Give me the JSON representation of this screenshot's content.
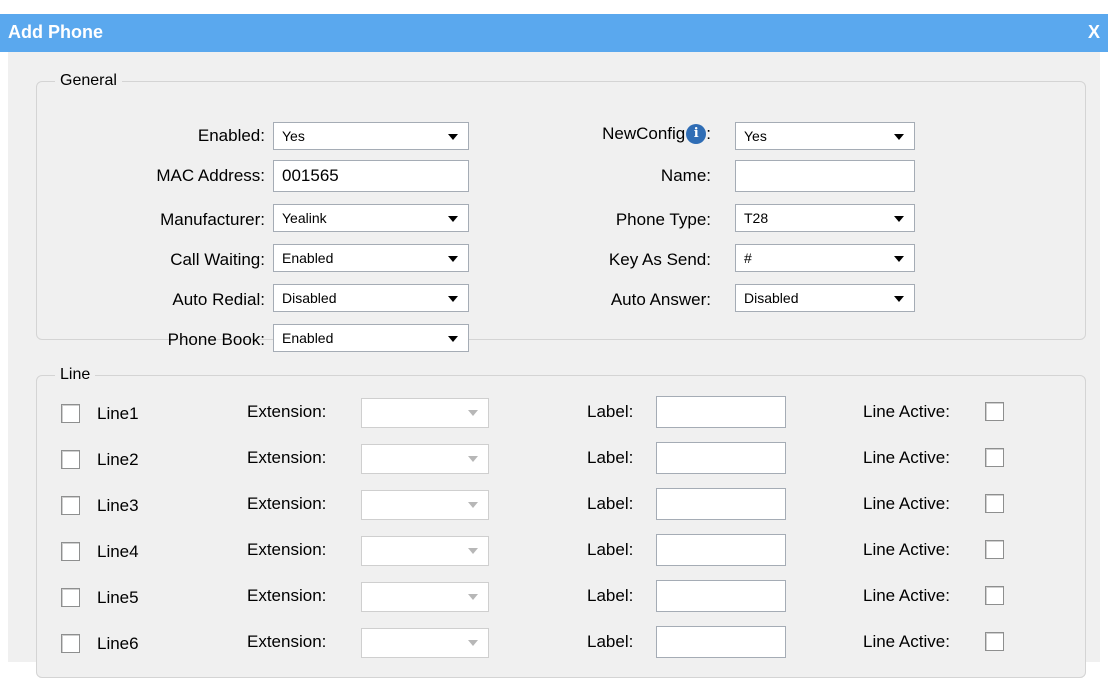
{
  "dialog": {
    "title": "Add Phone",
    "close_label": "X"
  },
  "general": {
    "legend": "General",
    "enabled": {
      "label": "Enabled:",
      "value": "Yes"
    },
    "newconfig": {
      "label": "NewConfig",
      "suffix": ":",
      "value": "Yes",
      "info_icon": "i"
    },
    "mac": {
      "label": "MAC Address:",
      "value": "001565"
    },
    "name": {
      "label": "Name:",
      "value": ""
    },
    "manufacturer": {
      "label": "Manufacturer:",
      "value": "Yealink"
    },
    "phone_type": {
      "label": "Phone Type:",
      "value": "T28"
    },
    "call_waiting": {
      "label": "Call Waiting:",
      "value": "Enabled"
    },
    "key_as_send": {
      "label": "Key As Send:",
      "value": "#"
    },
    "auto_redial": {
      "label": "Auto Redial:",
      "value": "Disabled"
    },
    "auto_answer": {
      "label": "Auto Answer:",
      "value": "Disabled"
    },
    "phone_book": {
      "label": "Phone Book:",
      "value": "Enabled"
    }
  },
  "line": {
    "legend": "Line",
    "extension_label": "Extension:",
    "label_label": "Label:",
    "active_label": "Line Active:",
    "rows": [
      {
        "name": "Line1",
        "extension": "",
        "label": ""
      },
      {
        "name": "Line2",
        "extension": "",
        "label": ""
      },
      {
        "name": "Line3",
        "extension": "",
        "label": ""
      },
      {
        "name": "Line4",
        "extension": "",
        "label": ""
      },
      {
        "name": "Line5",
        "extension": "",
        "label": ""
      },
      {
        "name": "Line6",
        "extension": "",
        "label": ""
      }
    ]
  }
}
